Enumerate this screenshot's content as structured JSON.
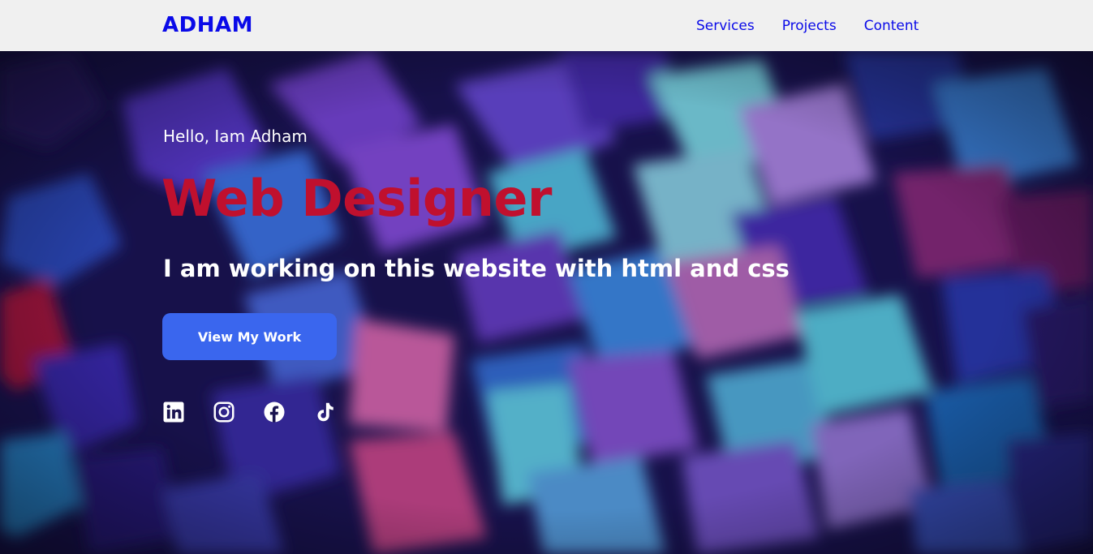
{
  "nav": {
    "logo": "ADHAM",
    "links": [
      {
        "label": "Services"
      },
      {
        "label": "Projects"
      },
      {
        "label": "Content"
      }
    ]
  },
  "hero": {
    "greeting": "Hello, Iam Adham",
    "role": "Web Designer",
    "tagline": "I am working on this website with html and css",
    "cta_label": "View My Work",
    "social_icons": [
      "linkedin-icon",
      "instagram-icon",
      "facebook-icon",
      "tiktok-icon"
    ]
  },
  "colors": {
    "nav_background": "#f0f0f0",
    "brand_blue": "#0a0ae8",
    "role_red": "#c0102e",
    "button_blue": "#3a66ee",
    "text_white": "#ffffff"
  }
}
